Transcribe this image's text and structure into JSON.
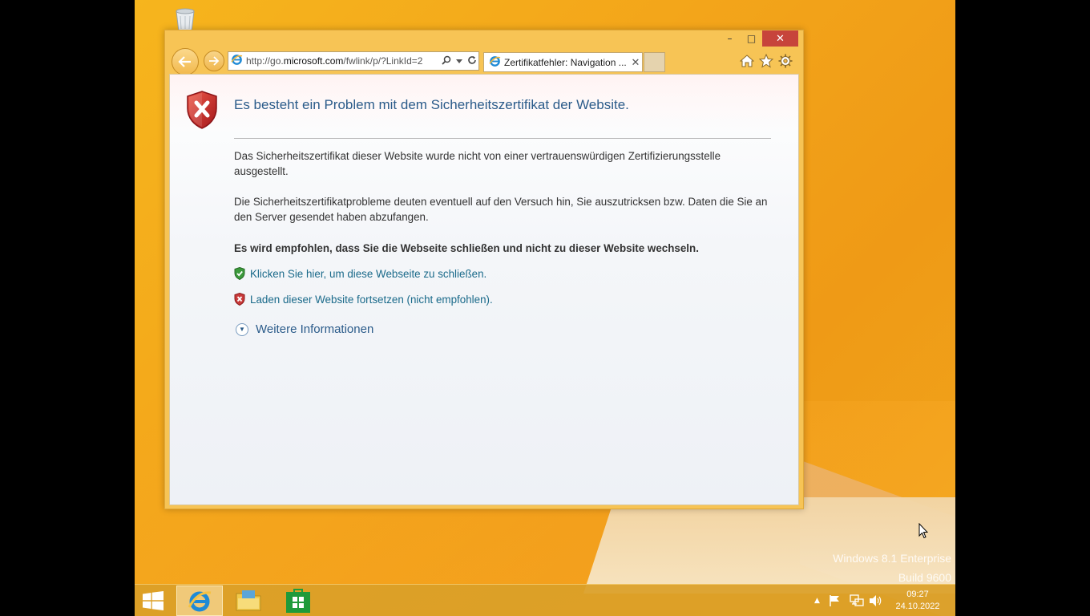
{
  "window": {
    "address_url_prefix": "http://go.",
    "address_url_domain": "microsoft.com",
    "address_url_suffix": "/fwlink/p/?LinkId=2",
    "tab_title": "Zertifikatfehler: Navigation ...",
    "min_label": "–",
    "max_label": "□",
    "close_label": "✕"
  },
  "page": {
    "headline": "Es besteht ein Problem mit dem Sicherheitszertifikat der Website.",
    "paragraph1": "Das Sicherheitszertifikat dieser Website wurde nicht von einer vertrauenswürdigen Zertifizierungsstelle ausgestellt.",
    "paragraph2": "Die Sicherheitszertifikatprobleme deuten eventuell auf den Versuch hin, Sie auszutricksen bzw. Daten die Sie an den Server gesendet haben abzufangen.",
    "recommendation": "Es wird empfohlen, dass Sie die Webseite schließen und nicht zu dieser Website wechseln.",
    "close_link": "Klicken Sie hier, um diese Webseite zu schließen.",
    "continue_link": "Laden dieser Website fortsetzen (nicht empfohlen).",
    "more_info": "Weitere Informationen"
  },
  "desktop": {
    "watermark_line1": "Windows 8.1 Enterprise",
    "watermark_line2": "Build 9600"
  },
  "taskbar": {
    "time": "09:27",
    "date": "24.10.2022"
  },
  "colors": {
    "link": "#1a6a8a",
    "headline": "#2b5b8a",
    "close_button": "#c7443b",
    "wallpaper": "#f3a51a"
  }
}
